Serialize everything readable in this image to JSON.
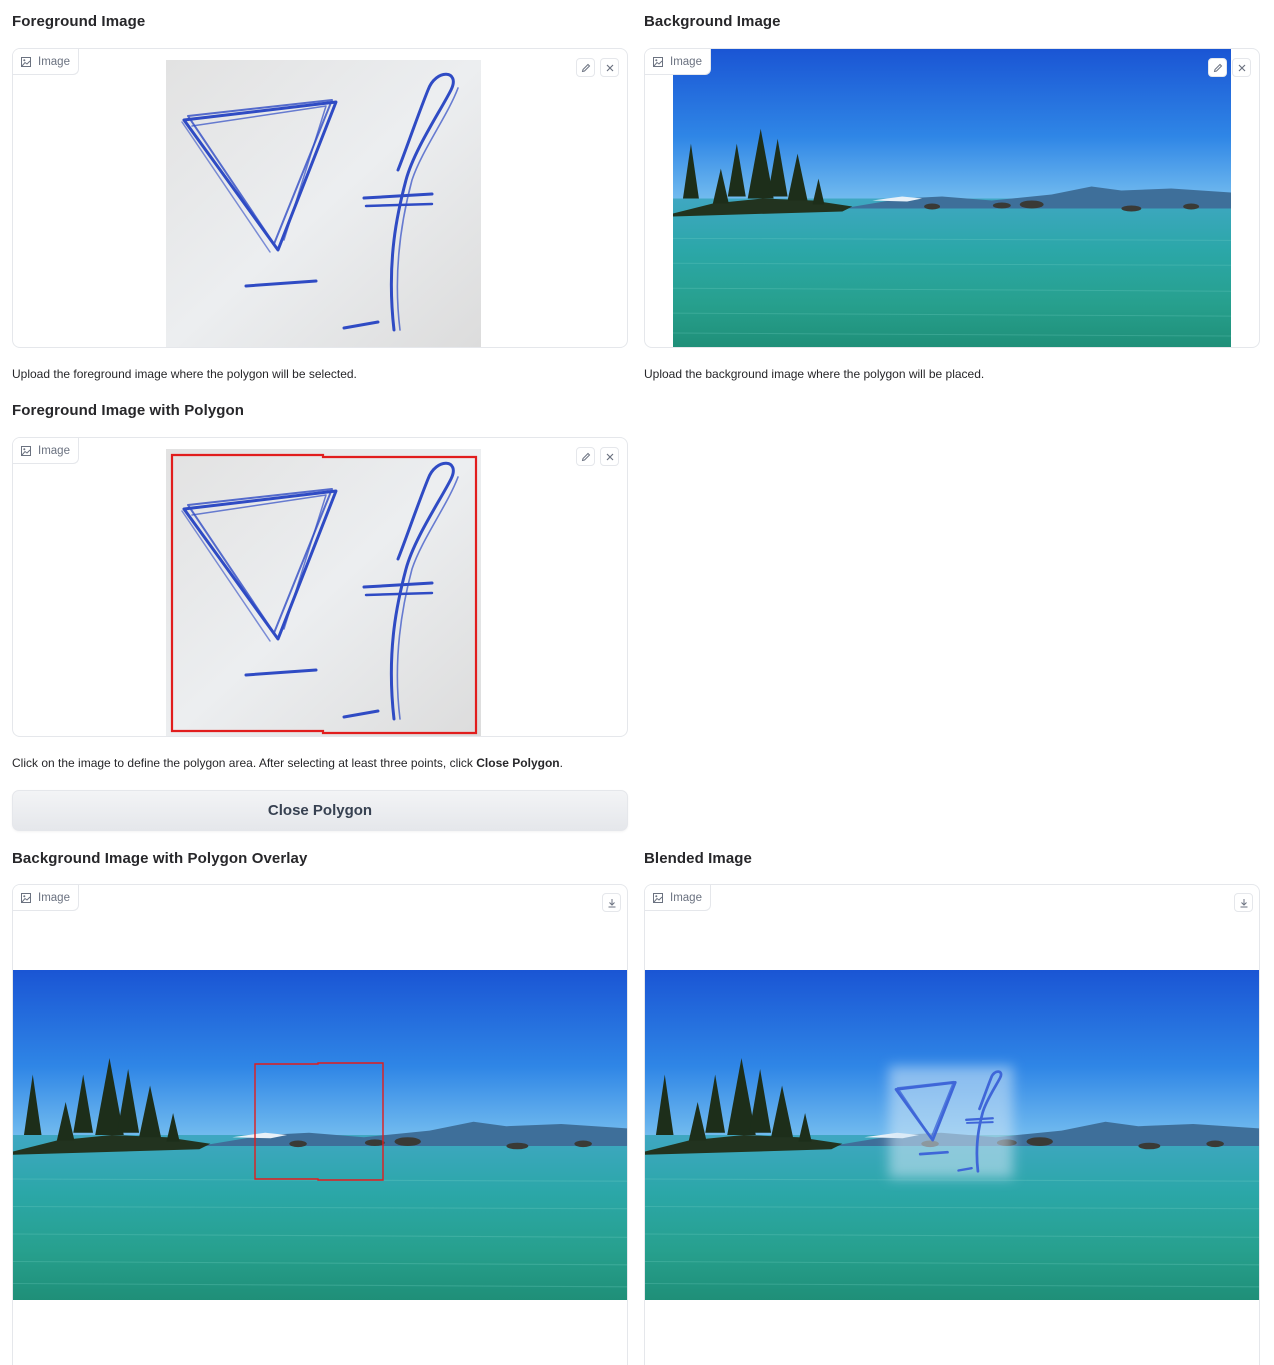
{
  "sections": {
    "foreground": {
      "title": "Foreground Image",
      "tag": "Image",
      "info": "Upload the foreground image where the polygon will be selected."
    },
    "background": {
      "title": "Background Image",
      "tag": "Image",
      "info": "Upload the background image where the polygon will be placed."
    },
    "polygon": {
      "title": "Foreground Image with Polygon",
      "tag": "Image",
      "info_prefix": "Click on the image to define the polygon area. After selecting at least three points, click ",
      "info_bold": "Close Polygon",
      "info_suffix": "."
    },
    "overlay": {
      "title": "Background Image with Polygon Overlay",
      "tag": "Image"
    },
    "blended": {
      "title": "Blended Image",
      "tag": "Image"
    }
  },
  "close_button": {
    "label": "Close Polygon"
  },
  "colors": {
    "polygon_outline": "#e11d1d",
    "ink": "#2f4bc4",
    "sky_top": "#1b57d6",
    "water": "#2aa59a"
  },
  "icons": [
    "image-icon",
    "edit-icon",
    "close-icon",
    "download-icon"
  ]
}
